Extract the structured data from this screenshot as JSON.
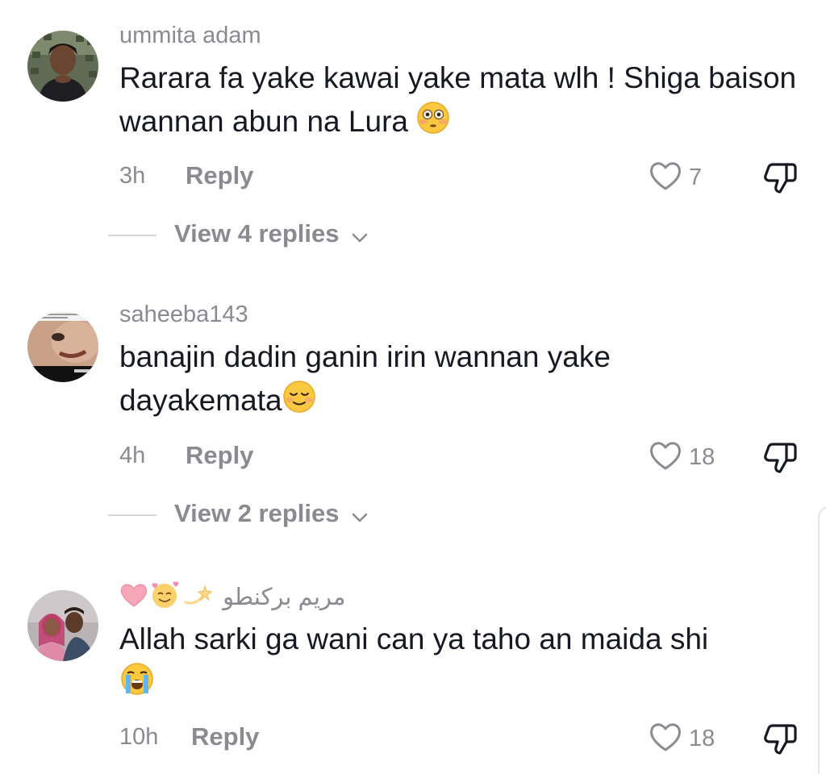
{
  "comments": [
    {
      "username": "ummita adam",
      "text": "Rarara fa yake kawai yake mata wlh ! Shiga baison wannan abun na Lura",
      "emoji": "flushed-face",
      "time": "3h",
      "reply_label": "Reply",
      "likes": "7",
      "view_replies": "View 4 replies"
    },
    {
      "username": "saheeba143",
      "text_line1": "banajin dadin ganin irin wannan yake",
      "text_line2": "dayakemata",
      "emoji": "relieved-face",
      "time": "4h",
      "reply_label": "Reply",
      "likes": "18",
      "view_replies": "View 2 replies"
    },
    {
      "username": "مريم بركنطو",
      "username_emojis": [
        "pink-heart",
        "smiling-face-with-hearts",
        "dizzy"
      ],
      "text": "Allah sarki ga wani can ya taho an maida shi",
      "emoji": "loudly-crying-face",
      "time": "10h",
      "reply_label": "Reply",
      "likes": "18"
    }
  ],
  "colors": {
    "text": "#161823",
    "secondary": "#8a8b91",
    "divider": "#d6d6d8"
  }
}
